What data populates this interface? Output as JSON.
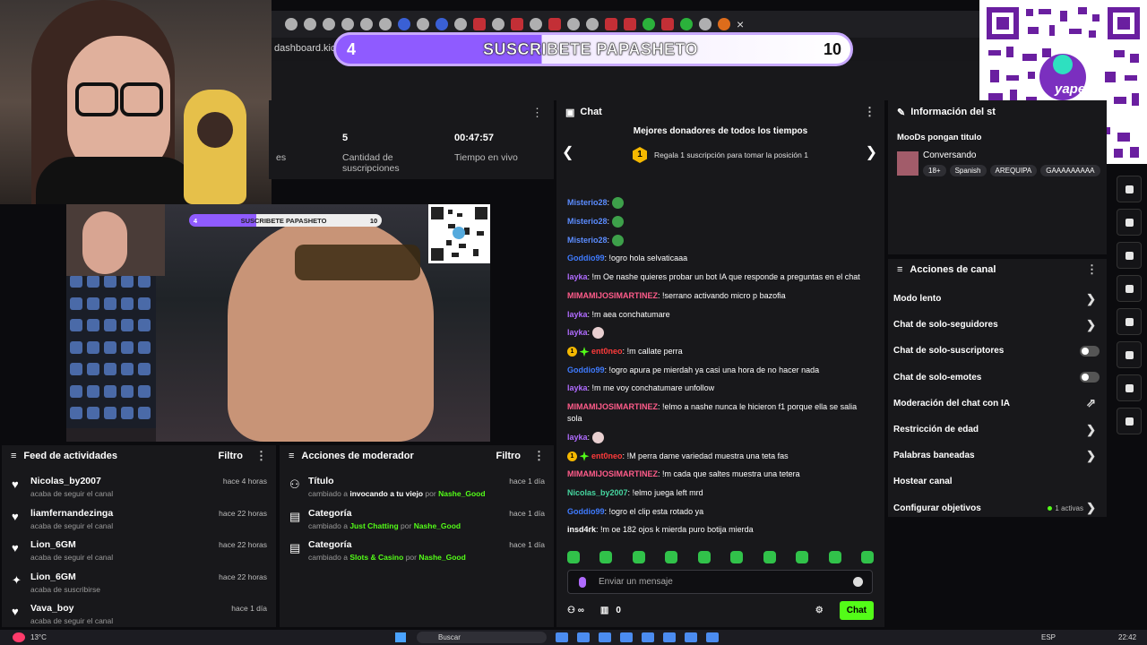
{
  "browser": {
    "address_text": "dashboard.kick",
    "close_icon": "×"
  },
  "sub_goal": {
    "current": "4",
    "text": "SUSCRIBETE PAPASHETO",
    "target": "10",
    "progress_fraction": 0.4
  },
  "stats": {
    "sub_count": "5",
    "sub_label": "Cantidad de suscripciones",
    "live_time": "00:47:57",
    "live_label": "Tiempo en vivo",
    "cut_label": "es"
  },
  "stream_overlay": {
    "current": "4",
    "text": "SUSCRIBETE PAPASHETO",
    "target": "10"
  },
  "feed": {
    "title": "Feed de actividades",
    "filter": "Filtro",
    "items": [
      {
        "icon": "heart-icon",
        "name": "Nicolas_by2007",
        "sub": "acaba de seguir el canal",
        "time": "hace 4 horas"
      },
      {
        "icon": "heart-icon",
        "name": "liamfernandezinga",
        "sub": "acaba de seguir el canal",
        "time": "hace 22 horas"
      },
      {
        "icon": "heart-icon",
        "name": "Lion_6GM",
        "sub": "acaba de seguir el canal",
        "time": "hace 22 horas"
      },
      {
        "icon": "star-icon",
        "name": "Lion_6GM",
        "sub": "acaba de suscribirse",
        "time": "hace 22 horas"
      },
      {
        "icon": "heart-icon",
        "name": "Vava_boy",
        "sub": "acaba de seguir el canal",
        "time": "hace 1 día"
      }
    ]
  },
  "mod": {
    "title": "Acciones de moderador",
    "filter": "Filtro",
    "items": [
      {
        "name": "Título",
        "pre": "cambiado a",
        "value": "invocando a tu viejo",
        "by": "por",
        "user": "Nashe_Good",
        "time": "hace 1 día"
      },
      {
        "name": "Categoría",
        "pre": "cambiado a",
        "value": "Just Chatting",
        "by": "por",
        "user": "Nashe_Good",
        "time": "hace 1 día"
      },
      {
        "name": "Categoría",
        "pre": "cambiado a",
        "value": "Slots & Casino",
        "by": "por",
        "user": "Nashe_Good",
        "time": "hace 1 día"
      }
    ]
  },
  "chat": {
    "title": "Chat",
    "donors_title": "Mejores donadores de todos los tiempos",
    "donors_badge": "1",
    "donors_sub": "Regala 1 suscripción para tomar la posición 1",
    "messages": [
      {
        "user": "Misterio28",
        "color": "#5b8cff",
        "text": ""
      },
      {
        "user": "Misterio28",
        "color": "#5b8cff",
        "text": ""
      },
      {
        "user": "Misterio28",
        "color": "#5b8cff",
        "text": ""
      },
      {
        "user": "Goddio99",
        "color": "#3f7bff",
        "text": "!ogro hola selvaticaaa"
      },
      {
        "user": "layka",
        "color": "#b06bff",
        "text": "!m Oe nashe quieres probar un bot IA que responde a preguntas en el chat"
      },
      {
        "user": "MIMAMIJOSIMARTINEZ",
        "color": "#ff5c8a",
        "text": "!serrano activando micro p bazofia"
      },
      {
        "user": "layka",
        "color": "#b06bff",
        "text": "!m aea conchatumare"
      },
      {
        "user": "layka",
        "color": "#b06bff",
        "text": ""
      },
      {
        "user": "ent0neo",
        "color": "#ff3b3b",
        "text": "!m callate perra"
      },
      {
        "user": "Goddio99",
        "color": "#3f7bff",
        "text": "!ogro apura pe mierdah ya casi una hora de no hacer nada"
      },
      {
        "user": "layka",
        "color": "#b06bff",
        "text": "!m me voy conchatumare unfollow"
      },
      {
        "user": "MIMAMIJOSIMARTINEZ",
        "color": "#ff5c8a",
        "text": "!elmo a nashe nunca le hicieron f1 porque ella se salia sola"
      },
      {
        "user": "layka",
        "color": "#b06bff",
        "text": ""
      },
      {
        "user": "ent0neo",
        "color": "#ff3b3b",
        "text": "!M perra dame variedad muestra una teta fas"
      },
      {
        "user": "MIMAMIJOSIMARTINEZ",
        "color": "#ff5c8a",
        "text": "!m cada que saltes muestra una tetera"
      },
      {
        "user": "Nicolas_by2007",
        "color": "#46d6a0",
        "text": "!elmo juega left mrd"
      },
      {
        "user": "Goddio99",
        "color": "#3f7bff",
        "text": "!ogro el clip esta rotado ya"
      },
      {
        "user": "insd4rk",
        "color": "#ffffff",
        "text": "!m oe 182 ojos k mierda puro botija mierda"
      }
    ],
    "input_placeholder": "Enviar un mensaje",
    "viewers": "0",
    "send_label": "Chat"
  },
  "info": {
    "title": "Información del st",
    "stream_title": "MooDs pongan titulo",
    "category": "Conversando",
    "tags": [
      "18+",
      "Spanish",
      "AREQUIPA",
      "GAAAAAAAAA"
    ]
  },
  "acciones": {
    "title": "Acciones de canal",
    "items": [
      {
        "label": "Modo lento",
        "control": "chevron"
      },
      {
        "label": "Chat de solo-seguidores",
        "control": "chevron"
      },
      {
        "label": "Chat de solo-suscriptores",
        "control": "toggle"
      },
      {
        "label": "Chat de solo-emotes",
        "control": "toggle"
      },
      {
        "label": "Moderación del chat con IA",
        "control": "external"
      },
      {
        "label": "Restricción de edad",
        "control": "chevron"
      },
      {
        "label": "Palabras baneadas",
        "control": "chevron"
      },
      {
        "label": "Hostear canal",
        "control": "none"
      },
      {
        "label": "Configurar objetivos",
        "control": "chevron",
        "extra": "1 activas"
      }
    ]
  },
  "taskbar": {
    "temperature": "13°C",
    "search": "Buscar",
    "lang": "ESP",
    "time": "22:42"
  },
  "colors": {
    "accent_green": "#53fc18",
    "panel_bg": "#18181b",
    "goal_purple": "#8f5bff"
  }
}
